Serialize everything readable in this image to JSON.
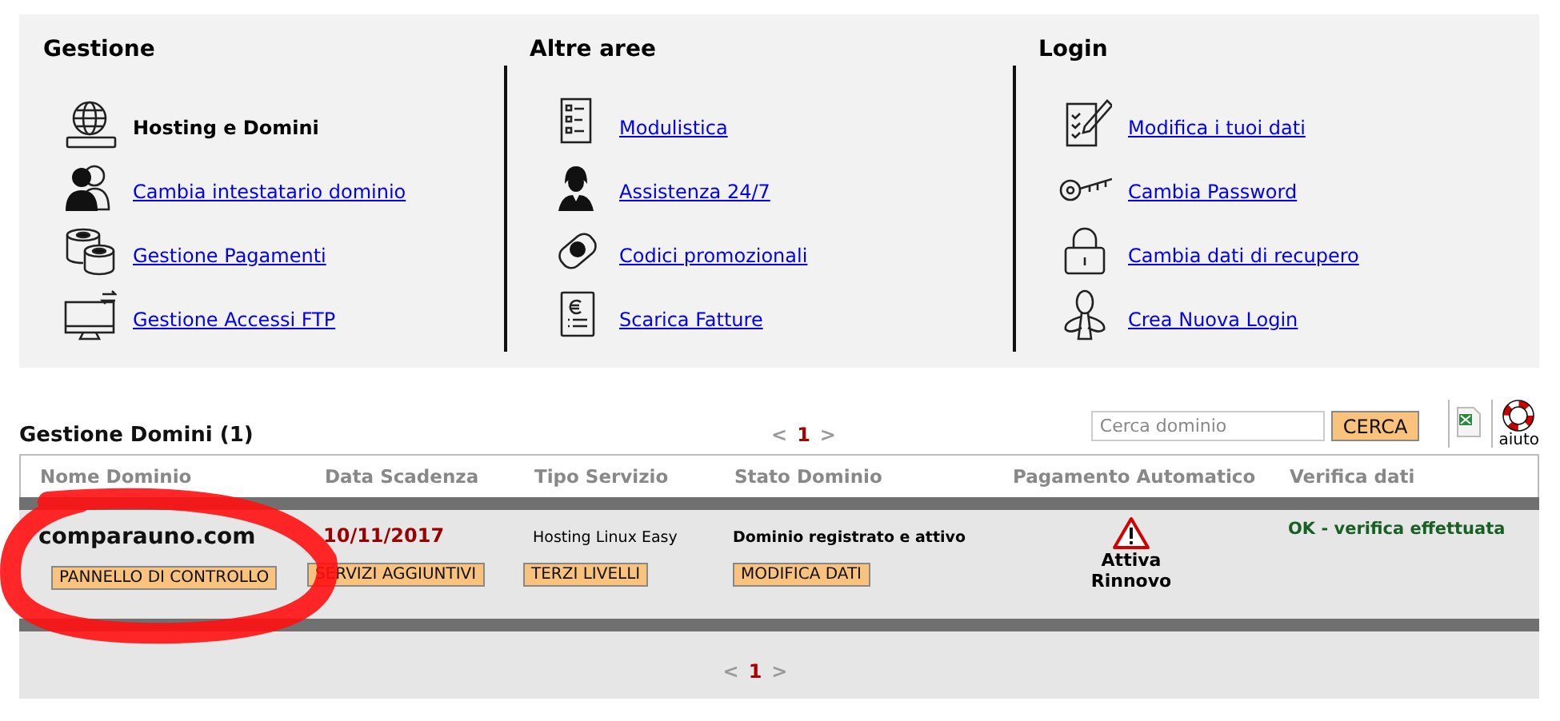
{
  "sections": [
    {
      "title": "Gestione",
      "items": [
        {
          "label": "Hosting e Domini",
          "kind": "current"
        },
        {
          "label": "Cambia intestatario dominio",
          "kind": "link"
        },
        {
          "label": "Gestione Pagamenti",
          "kind": "link"
        },
        {
          "label": "Gestione Accessi FTP",
          "kind": "link"
        }
      ]
    },
    {
      "title": "Altre aree",
      "items": [
        {
          "label": "Modulistica",
          "kind": "link"
        },
        {
          "label": "Assistenza 24/7",
          "kind": "link"
        },
        {
          "label": "Codici promozionali",
          "kind": "link"
        },
        {
          "label": "Scarica Fatture",
          "kind": "link"
        }
      ]
    },
    {
      "title": "Login",
      "items": [
        {
          "label": "Modifica i tuoi dati",
          "kind": "link"
        },
        {
          "label": "Cambia Password",
          "kind": "link"
        },
        {
          "label": "Cambia dati di recupero",
          "kind": "link"
        },
        {
          "label": "Crea Nuova Login",
          "kind": "link"
        }
      ]
    }
  ],
  "domains": {
    "title": "Gestione Domini (1)",
    "pager_top": {
      "prev": "<",
      "page": "1",
      "next": ">"
    },
    "search": {
      "placeholder": "Cerca dominio",
      "button": "CERCA"
    },
    "help": "aiuto",
    "columns": [
      "Nome Dominio",
      "Data Scadenza",
      "Tipo Servizio",
      "Stato Dominio",
      "Pagamento Automatico",
      "Verifica dati"
    ],
    "rows": [
      {
        "domain": "comparauno.com",
        "expiry": "10/11/2017",
        "service": "Hosting Linux Easy",
        "status": "Dominio registrato e attivo",
        "payment": "Attiva Rinnovo",
        "verification": "OK - verifica effettuata",
        "buttons": [
          "PANNELLO DI CONTROLLO",
          "SERVIZI AGGIUNTIVI",
          "TERZI LIVELLI",
          "MODIFICA DATI"
        ],
        "highlighted": true
      }
    ],
    "pager_bottom": {
      "prev": "<",
      "page": "1",
      "next": ">"
    }
  }
}
